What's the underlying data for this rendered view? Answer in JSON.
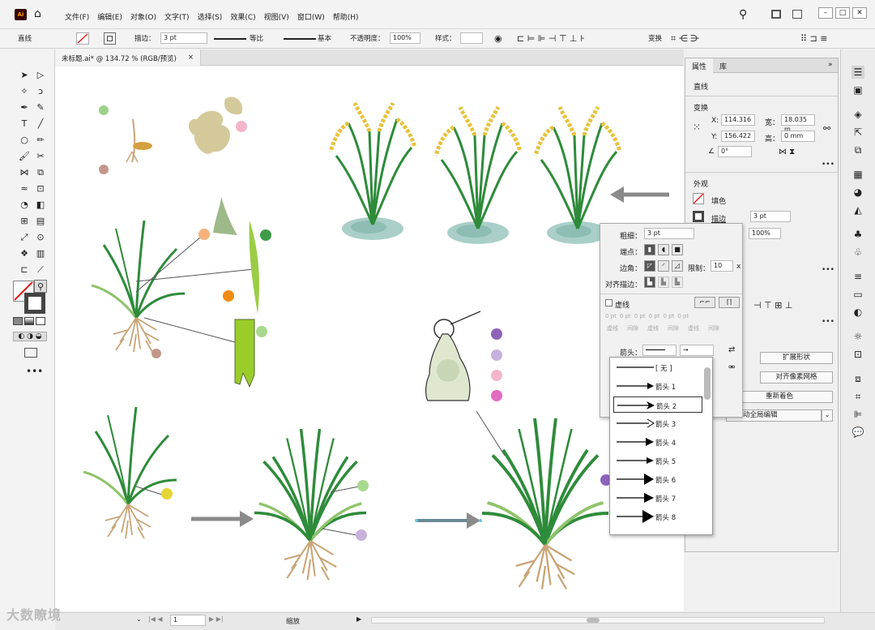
{
  "app": {
    "logo": "Ai"
  },
  "menu": [
    "文件(F)",
    "编辑(E)",
    "对象(O)",
    "文字(T)",
    "选择(S)",
    "效果(C)",
    "视图(V)",
    "窗口(W)",
    "帮助(H)"
  ],
  "control": {
    "object_type": "直线",
    "stroke_label": "描边：",
    "stroke_value": "3 pt",
    "profile": "等比",
    "brush": "基本",
    "opacity_label": "不透明度：",
    "opacity_value": "100%",
    "style_label": "样式：",
    "transform": "变换"
  },
  "document_tab": {
    "title": "未标题.ai* @ 134.72 % (RGB/预览)",
    "close": "×"
  },
  "properties": {
    "tab_properties": "属性",
    "tab_library": "库",
    "object_type": "直线",
    "transform_title": "变换",
    "x_label": "X:",
    "x_value": "114.316",
    "y_label": "Y:",
    "y_value": "156.422",
    "w_label": "宽：",
    "w_value": "18.035 m",
    "h_label": "高：",
    "h_value": "0 mm",
    "angle_value": "0°",
    "appearance_title": "外观",
    "fill_label": "填色",
    "stroke_label": "描边",
    "stroke_value": "3 pt",
    "opacity_value": "100%",
    "btn_expand": "扩展形状",
    "btn_pixel_grid": "对齐像素网格",
    "btn_recolor": "重新着色",
    "btn_global_edit": "动全局编辑"
  },
  "stroke_panel": {
    "weight_label": "粗细：",
    "weight_value": "3 pt",
    "cap_label": "端点：",
    "corner_label": "边角：",
    "limit_label": "限制：",
    "limit_value": "10",
    "limit_unit": "x",
    "align_label": "对齐描边：",
    "dashed_label": "虚线",
    "dash_values": [
      "0 pt",
      "0 pt",
      "0 pt",
      "0 pt",
      "0 pt",
      "0 pt"
    ],
    "dash_labels": [
      "虚线",
      "间隙",
      "虚线",
      "间隙",
      "虚线",
      "间隙"
    ],
    "arrow_label": "箭头："
  },
  "arrow_options": [
    "[ 无 ]",
    "箭头 1",
    "箭头 2",
    "箭头 3",
    "箭头 4",
    "箭头 5",
    "箭头 6",
    "箭头 7",
    "箭头 8"
  ],
  "status": {
    "zoom_label": "缩放",
    "page": "1"
  },
  "watermark": "大数瞭境",
  "colors": {
    "plant_green": "#2e8b3a",
    "leaf_light": "#8fc46b",
    "grain_yellow": "#e8c23c",
    "root_tan": "#c9a577",
    "water_teal": "#a9cfc8",
    "arrow_gray": "#8a8a8a"
  }
}
